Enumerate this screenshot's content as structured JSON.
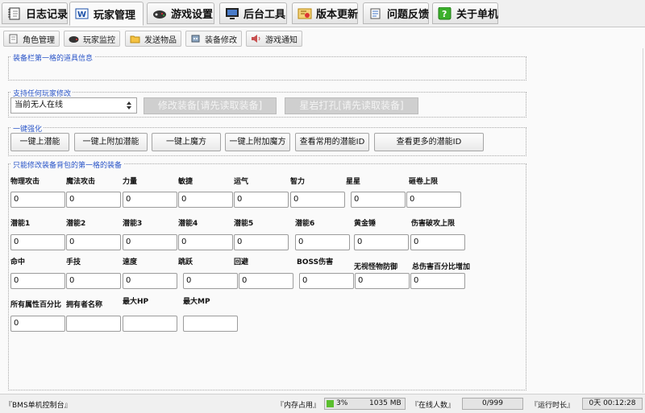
{
  "main_tabs": [
    {
      "label": "日志记录",
      "icon": "notebook-icon"
    },
    {
      "label": "玩家管理",
      "icon": "wordpad-icon"
    },
    {
      "label": "游戏设置",
      "icon": "gamepad-icon"
    },
    {
      "label": "后台工具",
      "icon": "monitor-icon"
    },
    {
      "label": "版本更新",
      "icon": "certificate-icon"
    },
    {
      "label": "问题反馈",
      "icon": "scroll-icon"
    },
    {
      "label": "关于单机",
      "icon": "help-icon"
    }
  ],
  "sub_tabs": [
    {
      "label": "角色管理",
      "icon": "clipboard-icon"
    },
    {
      "label": "玩家监控",
      "icon": "gamepad-icon"
    },
    {
      "label": "发送物品",
      "icon": "folder-icon"
    },
    {
      "label": "装备修改",
      "icon": "robot-icon"
    },
    {
      "label": "游戏通知",
      "icon": "speaker-icon"
    }
  ],
  "groups": {
    "equip_info": "装备栏第一格的道具信息",
    "player_modify": "支持任何玩家修改",
    "one_click": "一键强化",
    "bag_first": "只能修改装备背包的第一格的装备"
  },
  "player_select": {
    "value": "当前无人在线",
    "arrow": "▲▼"
  },
  "disabled_buttons": [
    "修改装备[请先读取装备]",
    "星岩打孔[请先读取装备]"
  ],
  "one_click_buttons": [
    "一键上潜能",
    "一键上附加潜能",
    "一键上魔方",
    "一键上附加魔方",
    "查看常用的潜能ID",
    "查看更多的潜能ID"
  ],
  "fields": {
    "row1": [
      {
        "label": "物理攻击",
        "value": "0"
      },
      {
        "label": "魔法攻击",
        "value": "0"
      },
      {
        "label": "力量",
        "value": "0"
      },
      {
        "label": "敏捷",
        "value": "0"
      },
      {
        "label": "运气",
        "value": "0"
      },
      {
        "label": "智力",
        "value": "0"
      },
      {
        "label": "星星",
        "value": "0"
      },
      {
        "label": "砸卷上限",
        "value": "0"
      }
    ],
    "row2": [
      {
        "label": "潜能1",
        "value": "0"
      },
      {
        "label": "潜能2",
        "value": "0"
      },
      {
        "label": "潜能3",
        "value": "0"
      },
      {
        "label": "潜能4",
        "value": "0"
      },
      {
        "label": "潜能5",
        "value": "0"
      },
      {
        "label": "潜能6",
        "value": "0"
      },
      {
        "label": "黄金锤",
        "value": "0"
      },
      {
        "label": "伤害破攻上限",
        "value": "0"
      }
    ],
    "row3": [
      {
        "label": "命中",
        "value": "0"
      },
      {
        "label": "手技",
        "value": "0"
      },
      {
        "label": "速度",
        "value": "0"
      },
      {
        "label": "跳跃",
        "value": "0"
      },
      {
        "label": "回避",
        "value": "0"
      },
      {
        "label": "BOSS伤害",
        "value": "0"
      },
      {
        "label": "无视怪物防御",
        "value": "0"
      },
      {
        "label": "总伤害百分比增加",
        "value": "0"
      }
    ],
    "row4": [
      {
        "label": "所有属性百分比",
        "value": "0"
      },
      {
        "label": "拥有者名称",
        "value": ""
      },
      {
        "label": "最大HP",
        "value": ""
      },
      {
        "label": "最大MP",
        "value": ""
      }
    ]
  },
  "status": {
    "app_label": "『BMS单机控制台』",
    "mem_label": "『内存占用』",
    "mem_percent": "3%",
    "mem_value": "1035 MB",
    "online_label": "『在线人数』",
    "online_value": "0/999",
    "runtime_label": "『运行时长』",
    "runtime_value": "0天 00:12:28"
  },
  "colors": {
    "group_title": "#2a55c8",
    "progress_green": "#5bbf2e"
  }
}
